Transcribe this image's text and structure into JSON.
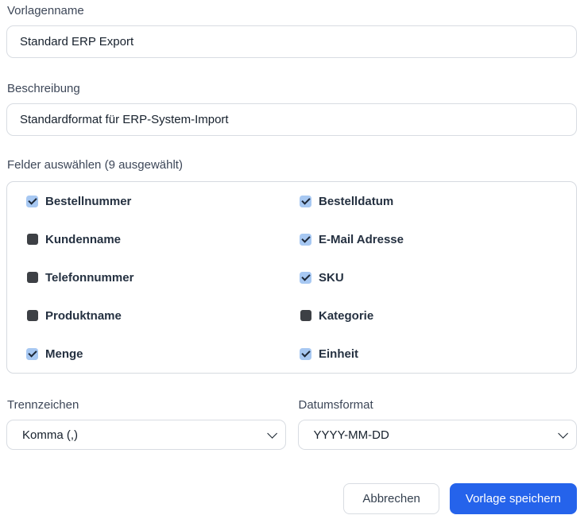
{
  "form": {
    "template_name": {
      "label": "Vorlagenname",
      "value": "Standard ERP Export"
    },
    "description": {
      "label": "Beschreibung",
      "value": "Standardformat für ERP-System-Import"
    },
    "fields": {
      "label": "Felder auswählen (9 ausgewählt)",
      "selected_count": 9,
      "items": [
        {
          "label": "Bestellnummer",
          "checked": true
        },
        {
          "label": "Bestelldatum",
          "checked": true
        },
        {
          "label": "Kundenname",
          "checked": false
        },
        {
          "label": "E-Mail Adresse",
          "checked": true
        },
        {
          "label": "Telefonnummer",
          "checked": false
        },
        {
          "label": "SKU",
          "checked": true
        },
        {
          "label": "Produktname",
          "checked": false
        },
        {
          "label": "Kategorie",
          "checked": false
        },
        {
          "label": "Menge",
          "checked": true
        },
        {
          "label": "Einheit",
          "checked": true
        }
      ]
    },
    "delimiter": {
      "label": "Trennzeichen",
      "value": "Komma (,)"
    },
    "date_format": {
      "label": "Datumsformat",
      "value": "YYYY-MM-DD"
    },
    "buttons": {
      "cancel": "Abbrechen",
      "save": "Vorlage speichern"
    }
  },
  "colors": {
    "primary_button": "#2563eb",
    "checkbox_checked_fill": "#a7c8f2",
    "checkbox_check": "#1d2838",
    "checkbox_unchecked_fill": "#3d4045"
  }
}
